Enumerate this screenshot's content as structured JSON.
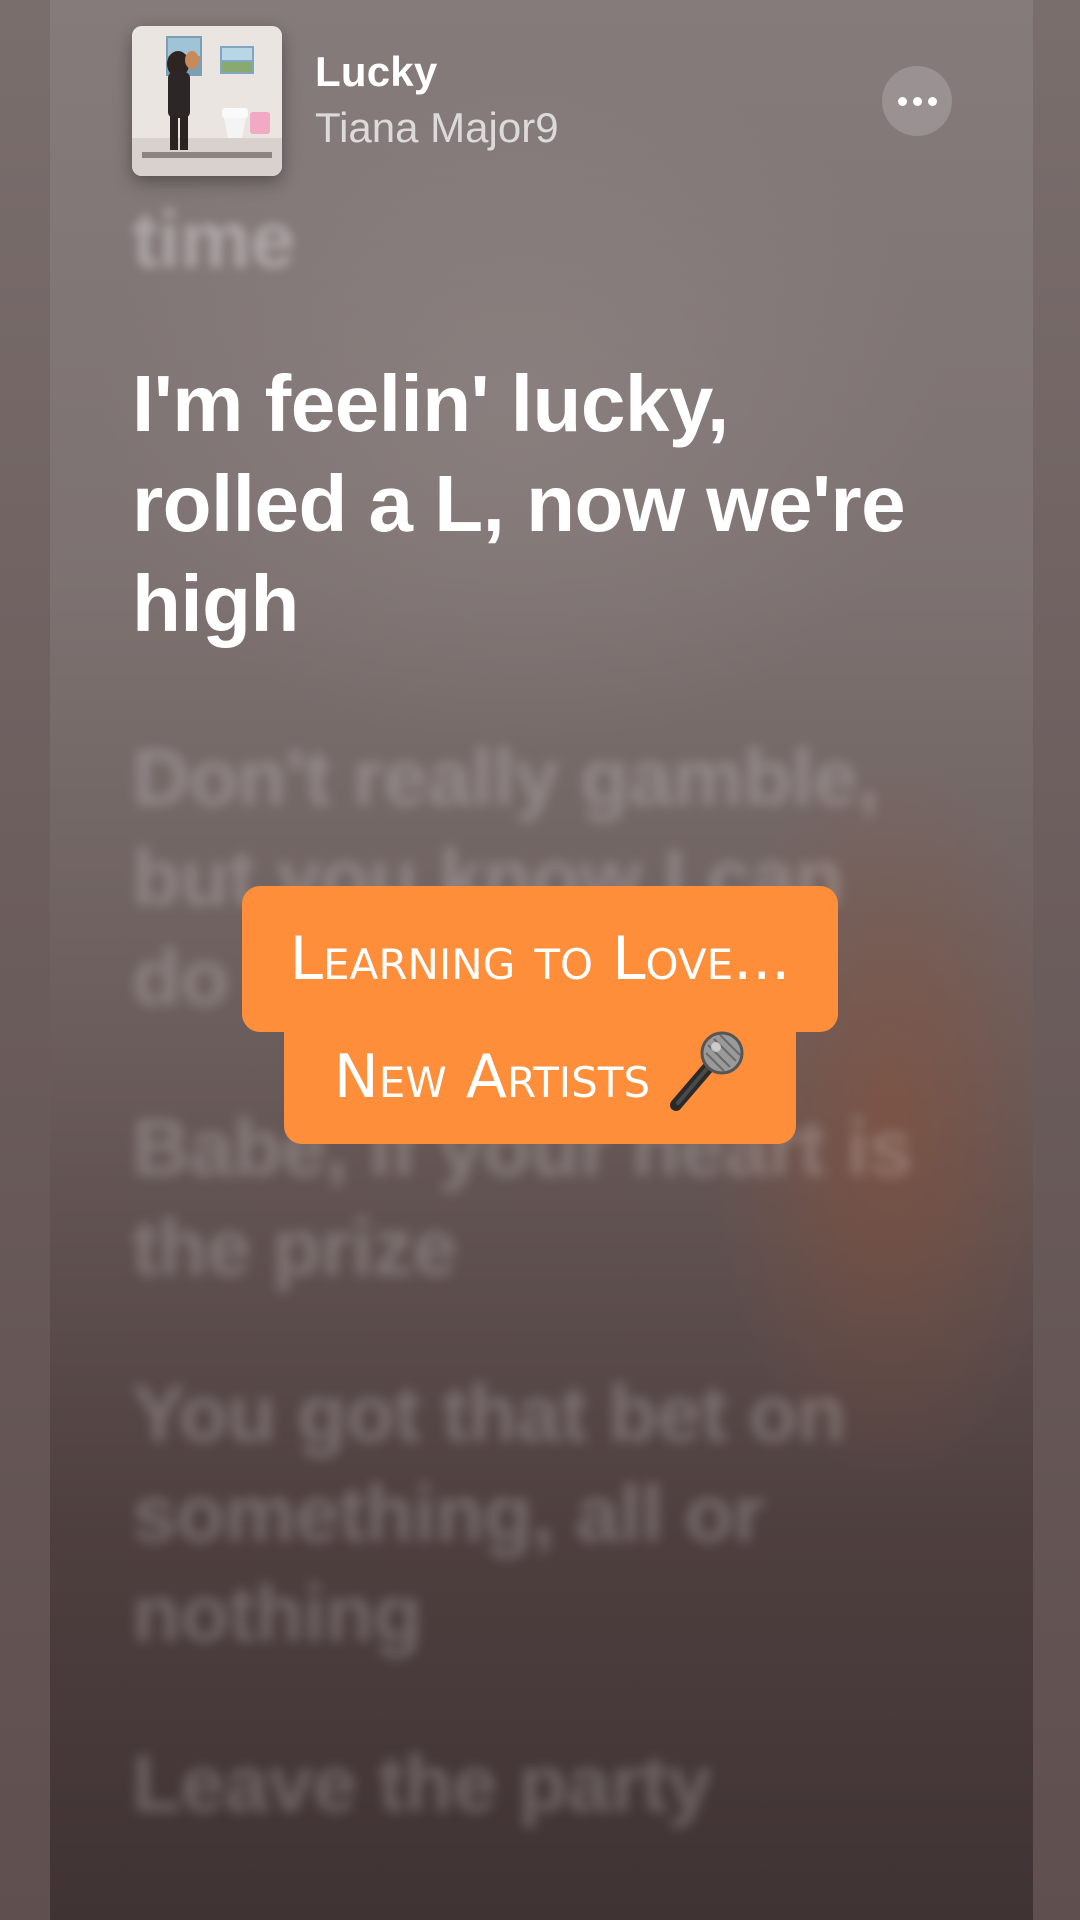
{
  "now_playing": {
    "title": "Lucky",
    "artist": "Tiana Major9",
    "more_button_label": "More"
  },
  "lyrics": {
    "previous": "time",
    "active": "I'm feelin' lucky, rolled a L, now we're high",
    "upcoming": [
      "Don't really gamble, but you know I can do",
      "Babe, if your heart is the prize",
      "You got that bet on something, all or nothing",
      "Leave the party"
    ]
  },
  "overlay_sticker": {
    "line_1": "Learning to Love...",
    "line_2": "New Artists",
    "icon": "microphone-icon",
    "color": "#ff8e3b"
  },
  "colors": {
    "background": "#7a6e6d",
    "text_active": "#ffffff",
    "sticker": "#ff8e3b"
  }
}
